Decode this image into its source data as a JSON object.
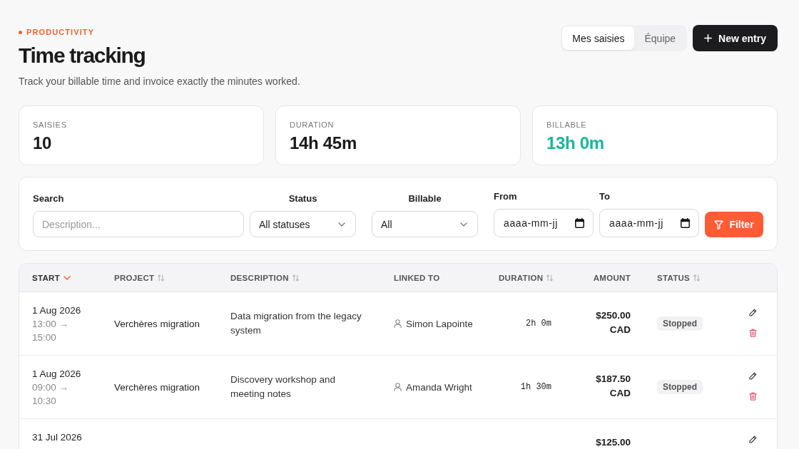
{
  "header": {
    "eyebrow": "PRODUCTIVITY",
    "title": "Time tracking",
    "subtitle": "Track your billable time and invoice exactly the minutes worked."
  },
  "view_tabs": [
    {
      "label": "Mes saisies",
      "selected": true
    },
    {
      "label": "Équipe",
      "selected": false
    }
  ],
  "new_entry_button": {
    "label": "New entry"
  },
  "stats": [
    {
      "label": "SAISIES",
      "value": "10",
      "kind": "plain"
    },
    {
      "label": "DURATION",
      "value": "14h 45m",
      "kind": "plain"
    },
    {
      "label": "BILLABLE",
      "value": "13h 0m",
      "kind": "accent"
    }
  ],
  "filters": {
    "fields": [
      {
        "kind": "search",
        "label": "Search",
        "placeholder": "Description..."
      },
      {
        "kind": "select",
        "label": "Status",
        "value": "All statuses"
      },
      {
        "kind": "select",
        "label": "Billable",
        "value": "All"
      },
      {
        "kind": "date",
        "label": "From",
        "placeholder": "aaaa-mm-jj"
      },
      {
        "kind": "date",
        "label": "To",
        "placeholder": "aaaa-mm-jj"
      }
    ],
    "button": {
      "label": "Filter"
    }
  },
  "table": {
    "columns": [
      {
        "label": "START",
        "sortable": true,
        "sorted": true
      },
      {
        "label": "PROJECT",
        "sortable": true,
        "sorted": false
      },
      {
        "label": "DESCRIPTION",
        "sortable": true,
        "sorted": false
      },
      {
        "label": "LINKED TO",
        "sortable": false,
        "sorted": false
      },
      {
        "label": "DURATION",
        "sortable": true,
        "sorted": false
      },
      {
        "label": "AMOUNT",
        "sortable": false,
        "sorted": false
      },
      {
        "label": "STATUS",
        "sortable": true,
        "sorted": false
      }
    ],
    "rows": [
      {
        "start_date": "1 Aug 2026",
        "time": "13:00 → 15:00",
        "project": "Verchères migration",
        "description": "Data migration from the legacy system",
        "linked_to": "Simon Lapointe",
        "duration": "2h 0m",
        "amount": "$250.00 CAD",
        "status": "Stopped",
        "actions": [
          {
            "kind": "edit"
          },
          {
            "kind": "delete"
          }
        ]
      },
      {
        "start_date": "1 Aug 2026",
        "time": "09:00 → 10:30",
        "project": "Verchères migration",
        "description": "Discovery workshop and meeting notes",
        "linked_to": "Amanda Wright",
        "duration": "1h 30m",
        "amount": "$187.50 CAD",
        "status": "Stopped",
        "actions": [
          {
            "kind": "edit"
          },
          {
            "kind": "delete"
          }
        ]
      },
      {
        "start_date": "31 Jul 2026",
        "amount": "$125.00",
        "actions": [
          {
            "kind": "edit"
          }
        ]
      }
    ]
  }
}
